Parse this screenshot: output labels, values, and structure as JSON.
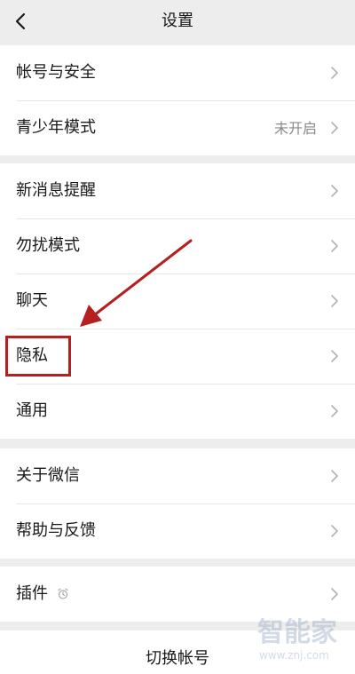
{
  "header": {
    "title": "设置"
  },
  "groups": [
    {
      "items": [
        {
          "label": "帐号与安全"
        },
        {
          "label": "青少年模式",
          "value": "未开启"
        }
      ]
    },
    {
      "items": [
        {
          "label": "新消息提醒"
        },
        {
          "label": "勿扰模式"
        },
        {
          "label": "聊天"
        },
        {
          "label": "隐私"
        },
        {
          "label": "通用"
        }
      ]
    },
    {
      "items": [
        {
          "label": "关于微信"
        },
        {
          "label": "帮助与反馈"
        }
      ]
    },
    {
      "items": [
        {
          "label": "插件"
        }
      ]
    }
  ],
  "bottom": {
    "switch_account": "切换帐号"
  },
  "watermark": {
    "brand": "智能家",
    "url": "www.znj.com"
  },
  "icons": {
    "back": "back-arrow-icon",
    "chevron": "chevron-right-icon",
    "plugin": "plugin-reminder-icon"
  },
  "colors": {
    "background": "#ededed",
    "highlight": "#b51f1f"
  }
}
